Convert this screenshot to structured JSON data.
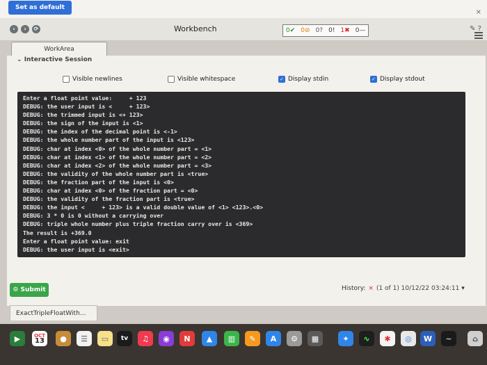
{
  "toolbar": {
    "set_default_label": "Set as default",
    "close": "×"
  },
  "window": {
    "title": "Workbench",
    "counters": [
      {
        "value": "0",
        "mark": "✔"
      },
      {
        "value": "0",
        "mark": "⊘"
      },
      {
        "value": "0",
        "mark": "?"
      },
      {
        "value": "0",
        "mark": "!"
      },
      {
        "value": "1",
        "mark": "✖"
      },
      {
        "value": "0",
        "mark": "—"
      }
    ]
  },
  "workarea": {
    "tab_label": "WorkArea",
    "session_label": "Interactive Session"
  },
  "options": [
    {
      "label": "Visible newlines",
      "checked": false
    },
    {
      "label": "Visible whitespace",
      "checked": false
    },
    {
      "label": "Display stdin",
      "checked": true
    },
    {
      "label": "Display stdout",
      "checked": true
    }
  ],
  "console": {
    "lines": [
      "Enter a float point value:     + 123",
      "DEBUG: the user input is <     + 123>",
      "DEBUG: the trimmed input is <+ 123>",
      "DEBUG: the sign of the input is <1>",
      "DEBUG: the index of the decimal point is <-1>",
      "DEBUG: the whole number part of the input is <123>",
      "DEBUG: char at index <0> of the whole number part = <1>",
      "DEBUG: char at index <1> of the whole number part = <2>",
      "DEBUG: char at index <2> of the whole number part = <3>",
      "DEBUG: the validity of the whole number part is <true>",
      "DEBUG: the fraction part of the input is <0>",
      "DEBUG: char at index <0> of the fraction part = <0>",
      "DEBUG: the validity of the fraction part is <true>",
      "DEBUG: the input <     + 123> is a valid double value of <1> <123>.<0>",
      "DEBUG: 3 * 0 is 0 without a carrying over",
      "DEBUG: triple whole number plus triple fraction carry over is <369>",
      "The result is +369.0",
      "Enter a float point value: exit",
      "DEBUG: the user input is <exit>"
    ]
  },
  "actions": {
    "submit_label": "Submit",
    "history_label": "History:",
    "history_x": "×",
    "history_meta": "(1 of 1) 10/12/22 03:24:11"
  },
  "file_tab": {
    "label": "ExactTripleFloatWith..."
  },
  "dock": {
    "calendar_month": "OCT",
    "calendar_day": "13",
    "tv_label": "tv"
  }
}
